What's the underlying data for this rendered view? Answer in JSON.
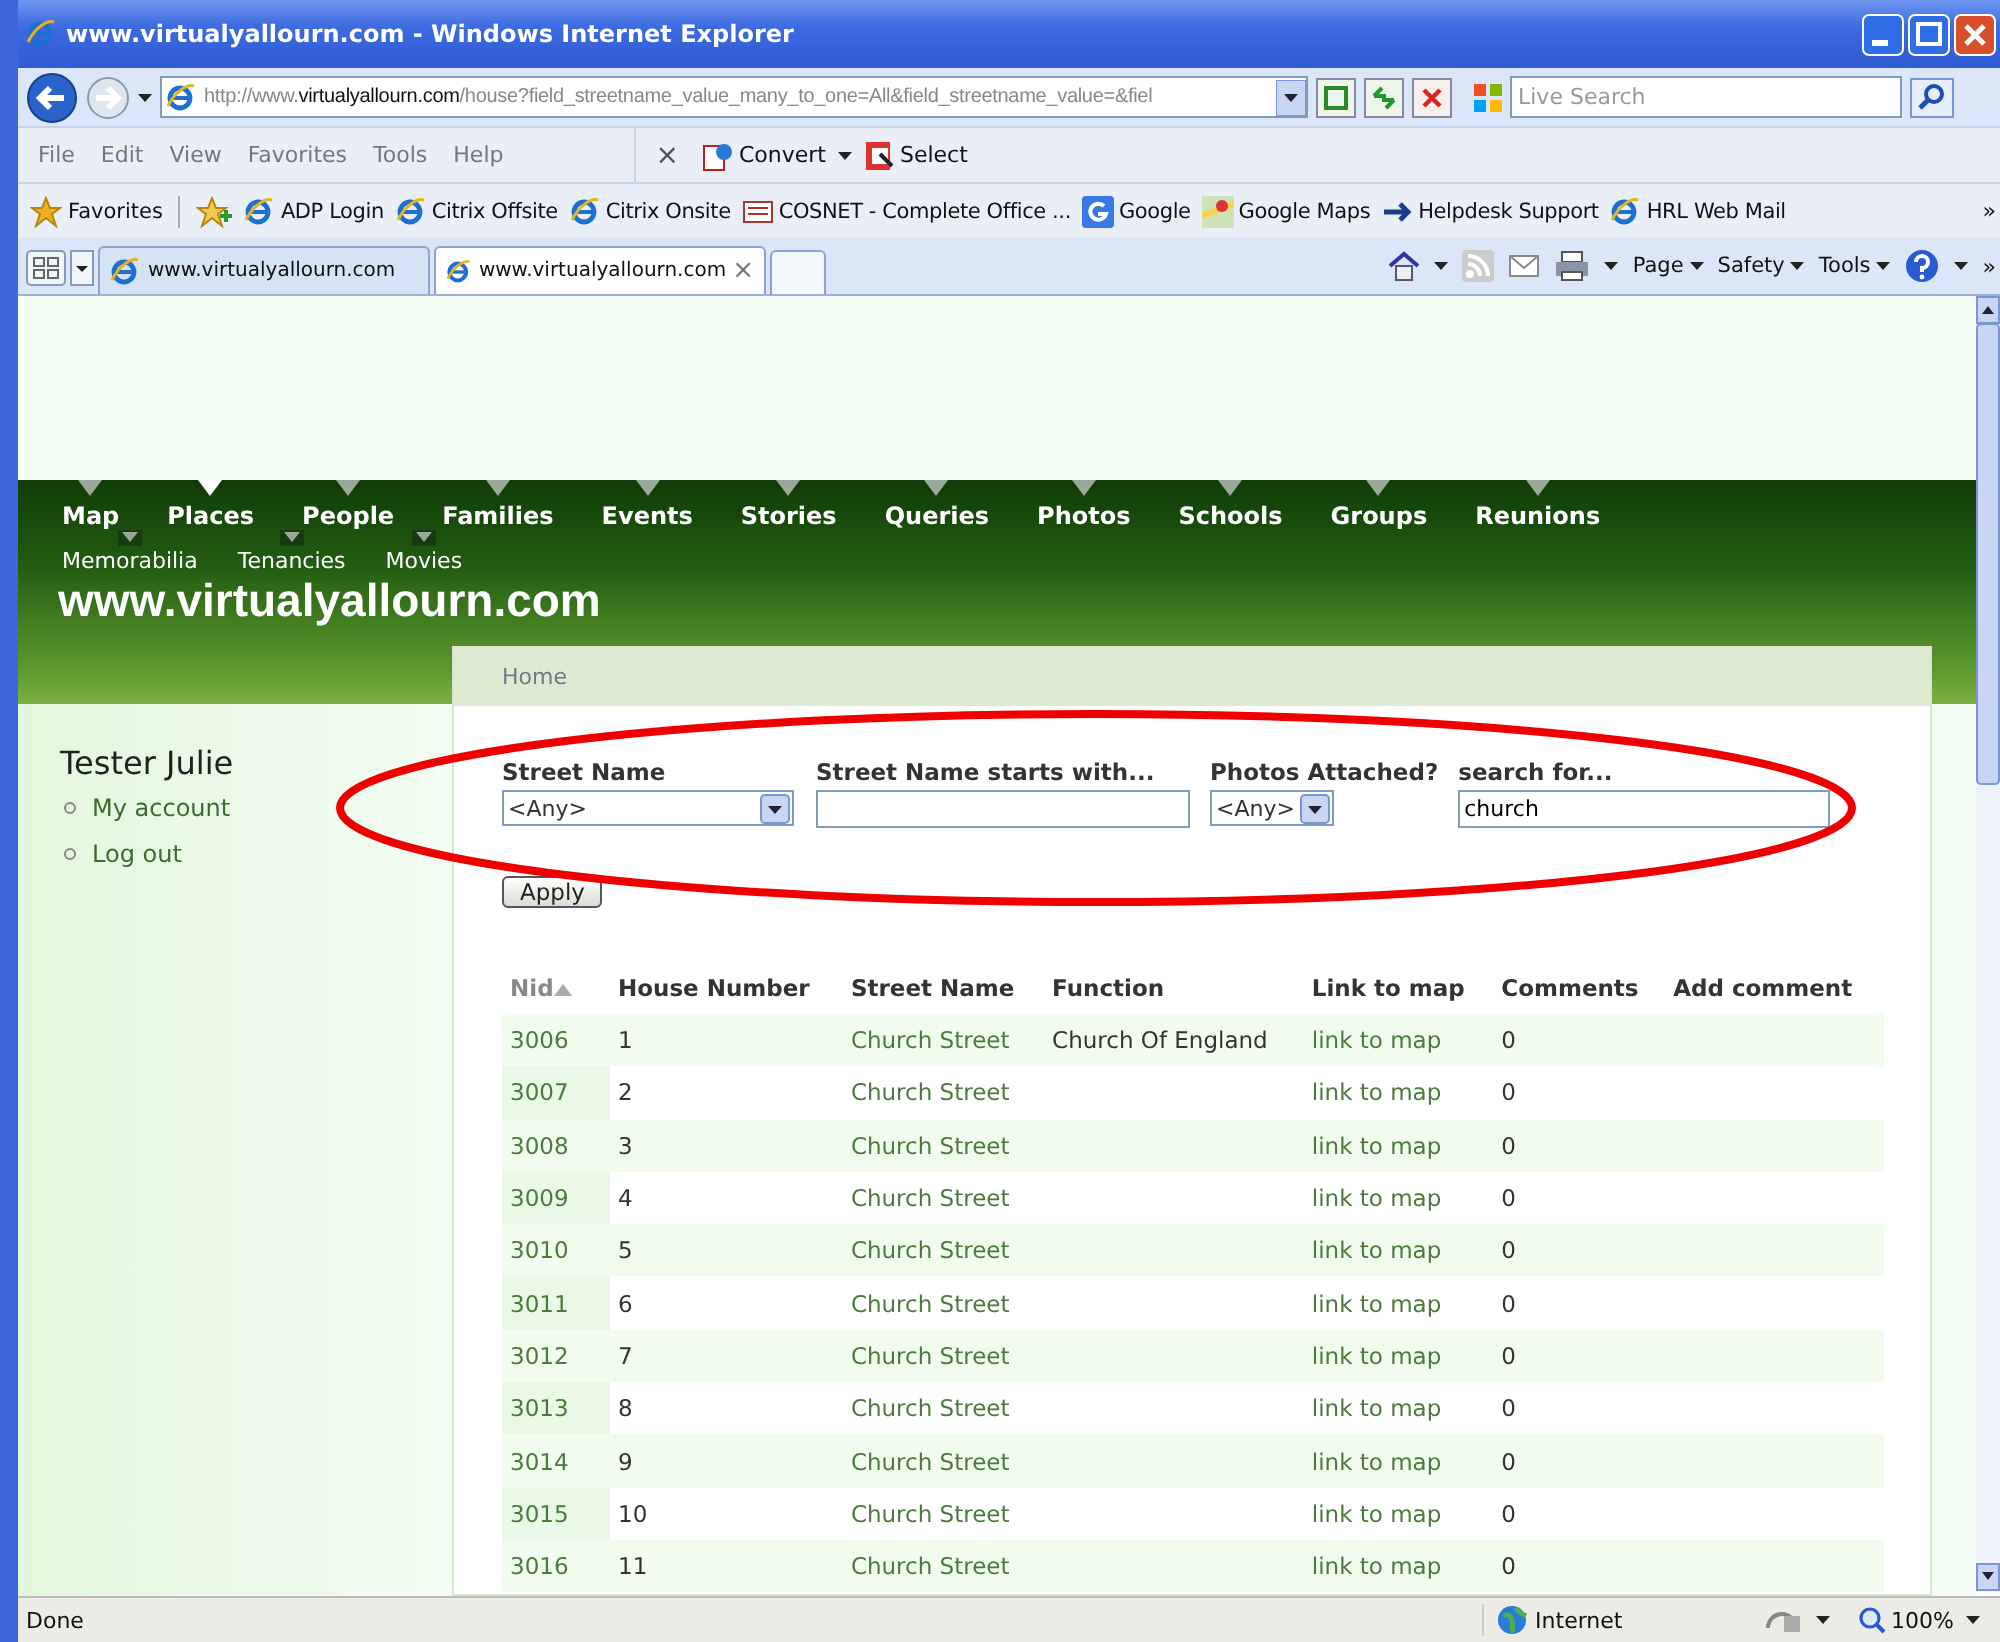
{
  "window": {
    "title": "www.virtualyallourn.com - Windows Internet Explorer"
  },
  "address": {
    "prefix": "http://www.",
    "domain": "virtualyallourn.com",
    "rest": "/house?field_streetname_value_many_to_one=All&field_streetname_value=&fiel"
  },
  "search": {
    "placeholder": "Live Search"
  },
  "menu": [
    "File",
    "Edit",
    "View",
    "Favorites",
    "Tools",
    "Help"
  ],
  "commands": [
    {
      "kind": "close",
      "label": "×"
    },
    {
      "kind": "convert",
      "label": "Convert"
    },
    {
      "kind": "select",
      "label": "Select"
    }
  ],
  "favorites": {
    "label": "Favorites",
    "links": [
      {
        "kind": "ie",
        "label": "ADP Login"
      },
      {
        "kind": "ie",
        "label": "Citrix Offsite"
      },
      {
        "kind": "ie",
        "label": "Citrix Onsite"
      },
      {
        "kind": "doc",
        "label": "COSNET - Complete Office ..."
      },
      {
        "kind": "google",
        "label": "Google"
      },
      {
        "kind": "maps",
        "label": "Google Maps"
      },
      {
        "kind": "arrow",
        "label": "Helpdesk Support"
      },
      {
        "kind": "ie",
        "label": "HRL Web Mail"
      }
    ],
    "more": "»"
  },
  "tabs": [
    {
      "label": "www.virtualyallourn.com",
      "selected": false
    },
    {
      "label": "www.virtualyallourn.com",
      "selected": true
    }
  ],
  "tab_close": "×",
  "tools": [
    "Page",
    "Safety",
    "Tools"
  ],
  "tools_more": "»",
  "nav": {
    "rows": [
      [
        {
          "label": "Map",
          "selected": false
        },
        {
          "label": "Places",
          "selected": true
        },
        {
          "label": "People",
          "selected": false
        },
        {
          "label": "Families",
          "selected": false
        },
        {
          "label": "Events",
          "selected": false
        },
        {
          "label": "Stories",
          "selected": false
        },
        {
          "label": "Queries",
          "selected": false
        },
        {
          "label": "Photos",
          "selected": false
        },
        {
          "label": "Schools",
          "selected": false
        },
        {
          "label": "Groups",
          "selected": false
        },
        {
          "label": "Reunions",
          "selected": false
        }
      ],
      [
        {
          "label": "Memorabilia",
          "selected": false
        },
        {
          "label": "Tenancies",
          "selected": false
        },
        {
          "label": "Movies",
          "selected": false
        }
      ]
    ]
  },
  "site_title": "www.virtualyallourn.com",
  "breadcrumb": "Home",
  "user": {
    "name": "Tester Julie",
    "links": [
      "My account",
      "Log out"
    ]
  },
  "filters": [
    {
      "kind": "select",
      "label": "Street Name",
      "value": "<Any>"
    },
    {
      "kind": "text",
      "label": "Street Name starts with..."
    },
    {
      "kind": "select",
      "label": "Photos Attached?",
      "value": "<Any>"
    },
    {
      "kind": "text",
      "label": "search for...",
      "value": "church"
    }
  ],
  "apply": "Apply",
  "annotation": {
    "kind": "ellipse"
  },
  "table": {
    "columns": [
      "Nid",
      "House Number",
      "Street Name",
      "Function",
      "Link to map",
      "Comments",
      "Add comment"
    ],
    "rows": [
      [
        "3006",
        "1",
        "Church Street",
        "Church Of England",
        "link to map",
        "0"
      ],
      [
        "3007",
        "2",
        "Church Street",
        "",
        "link to map",
        "0"
      ],
      [
        "3008",
        "3",
        "Church Street",
        "",
        "link to map",
        "0"
      ],
      [
        "3009",
        "4",
        "Church Street",
        "",
        "link to map",
        "0"
      ],
      [
        "3010",
        "5",
        "Church Street",
        "",
        "link to map",
        "0"
      ],
      [
        "3011",
        "6",
        "Church Street",
        "",
        "link to map",
        "0"
      ],
      [
        "3012",
        "7",
        "Church Street",
        "",
        "link to map",
        "0"
      ],
      [
        "3013",
        "8",
        "Church Street",
        "",
        "link to map",
        "0"
      ],
      [
        "3014",
        "9",
        "Church Street",
        "",
        "link to map",
        "0"
      ],
      [
        "3015",
        "10",
        "Church Street",
        "",
        "link to map",
        "0"
      ],
      [
        "3016",
        "11",
        "Church Street",
        "",
        "link to map",
        "0"
      ]
    ]
  },
  "status_bar": {
    "text": "Done",
    "zone": "Internet",
    "zoom": "100%"
  }
}
